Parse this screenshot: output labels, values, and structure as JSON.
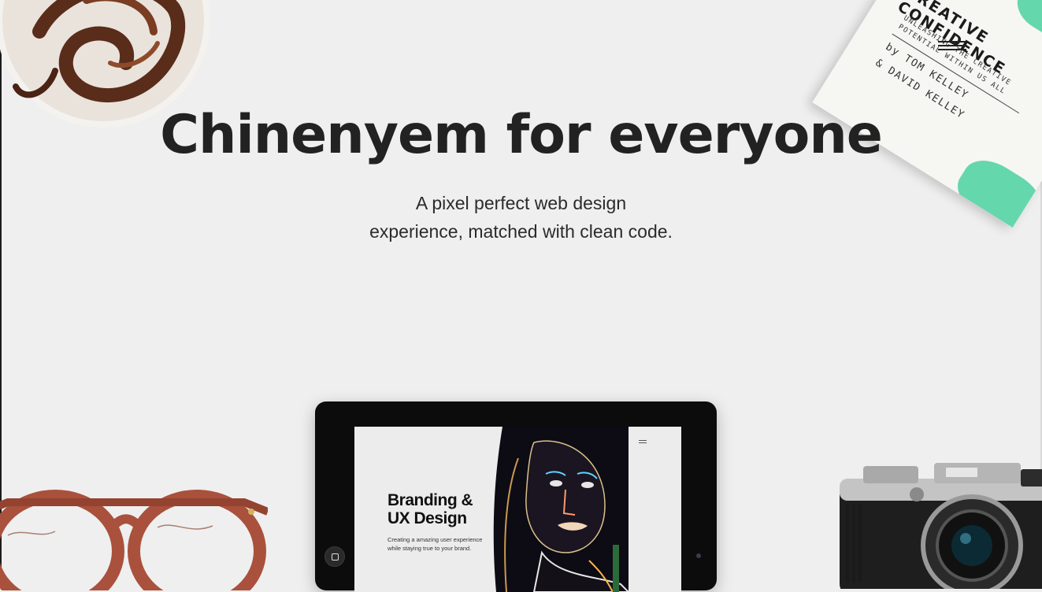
{
  "hero": {
    "title": "Chinenyem for everyone",
    "subtitle_line1": "A pixel perfect web design",
    "subtitle_line2": "experience, matched with clean code."
  },
  "book": {
    "title": "CREATIVE CONFIDENCE",
    "tagline_line1": "UNLEASHING THE CREATIVE",
    "tagline_line2": "POTENTIAL WITHIN US ALL",
    "author1": "by TOM KELLEY",
    "author2": "& DAVID KELLEY"
  },
  "tablet_screen": {
    "heading_line1": "Branding &",
    "heading_line2": "UX Design",
    "text_line1": "Creating a amazing user experience",
    "text_line2": "while staying true to your brand."
  },
  "colors": {
    "background": "#efefef",
    "accent_green": "#55d4a4",
    "heading": "#222222",
    "glasses": "#a9513c"
  }
}
